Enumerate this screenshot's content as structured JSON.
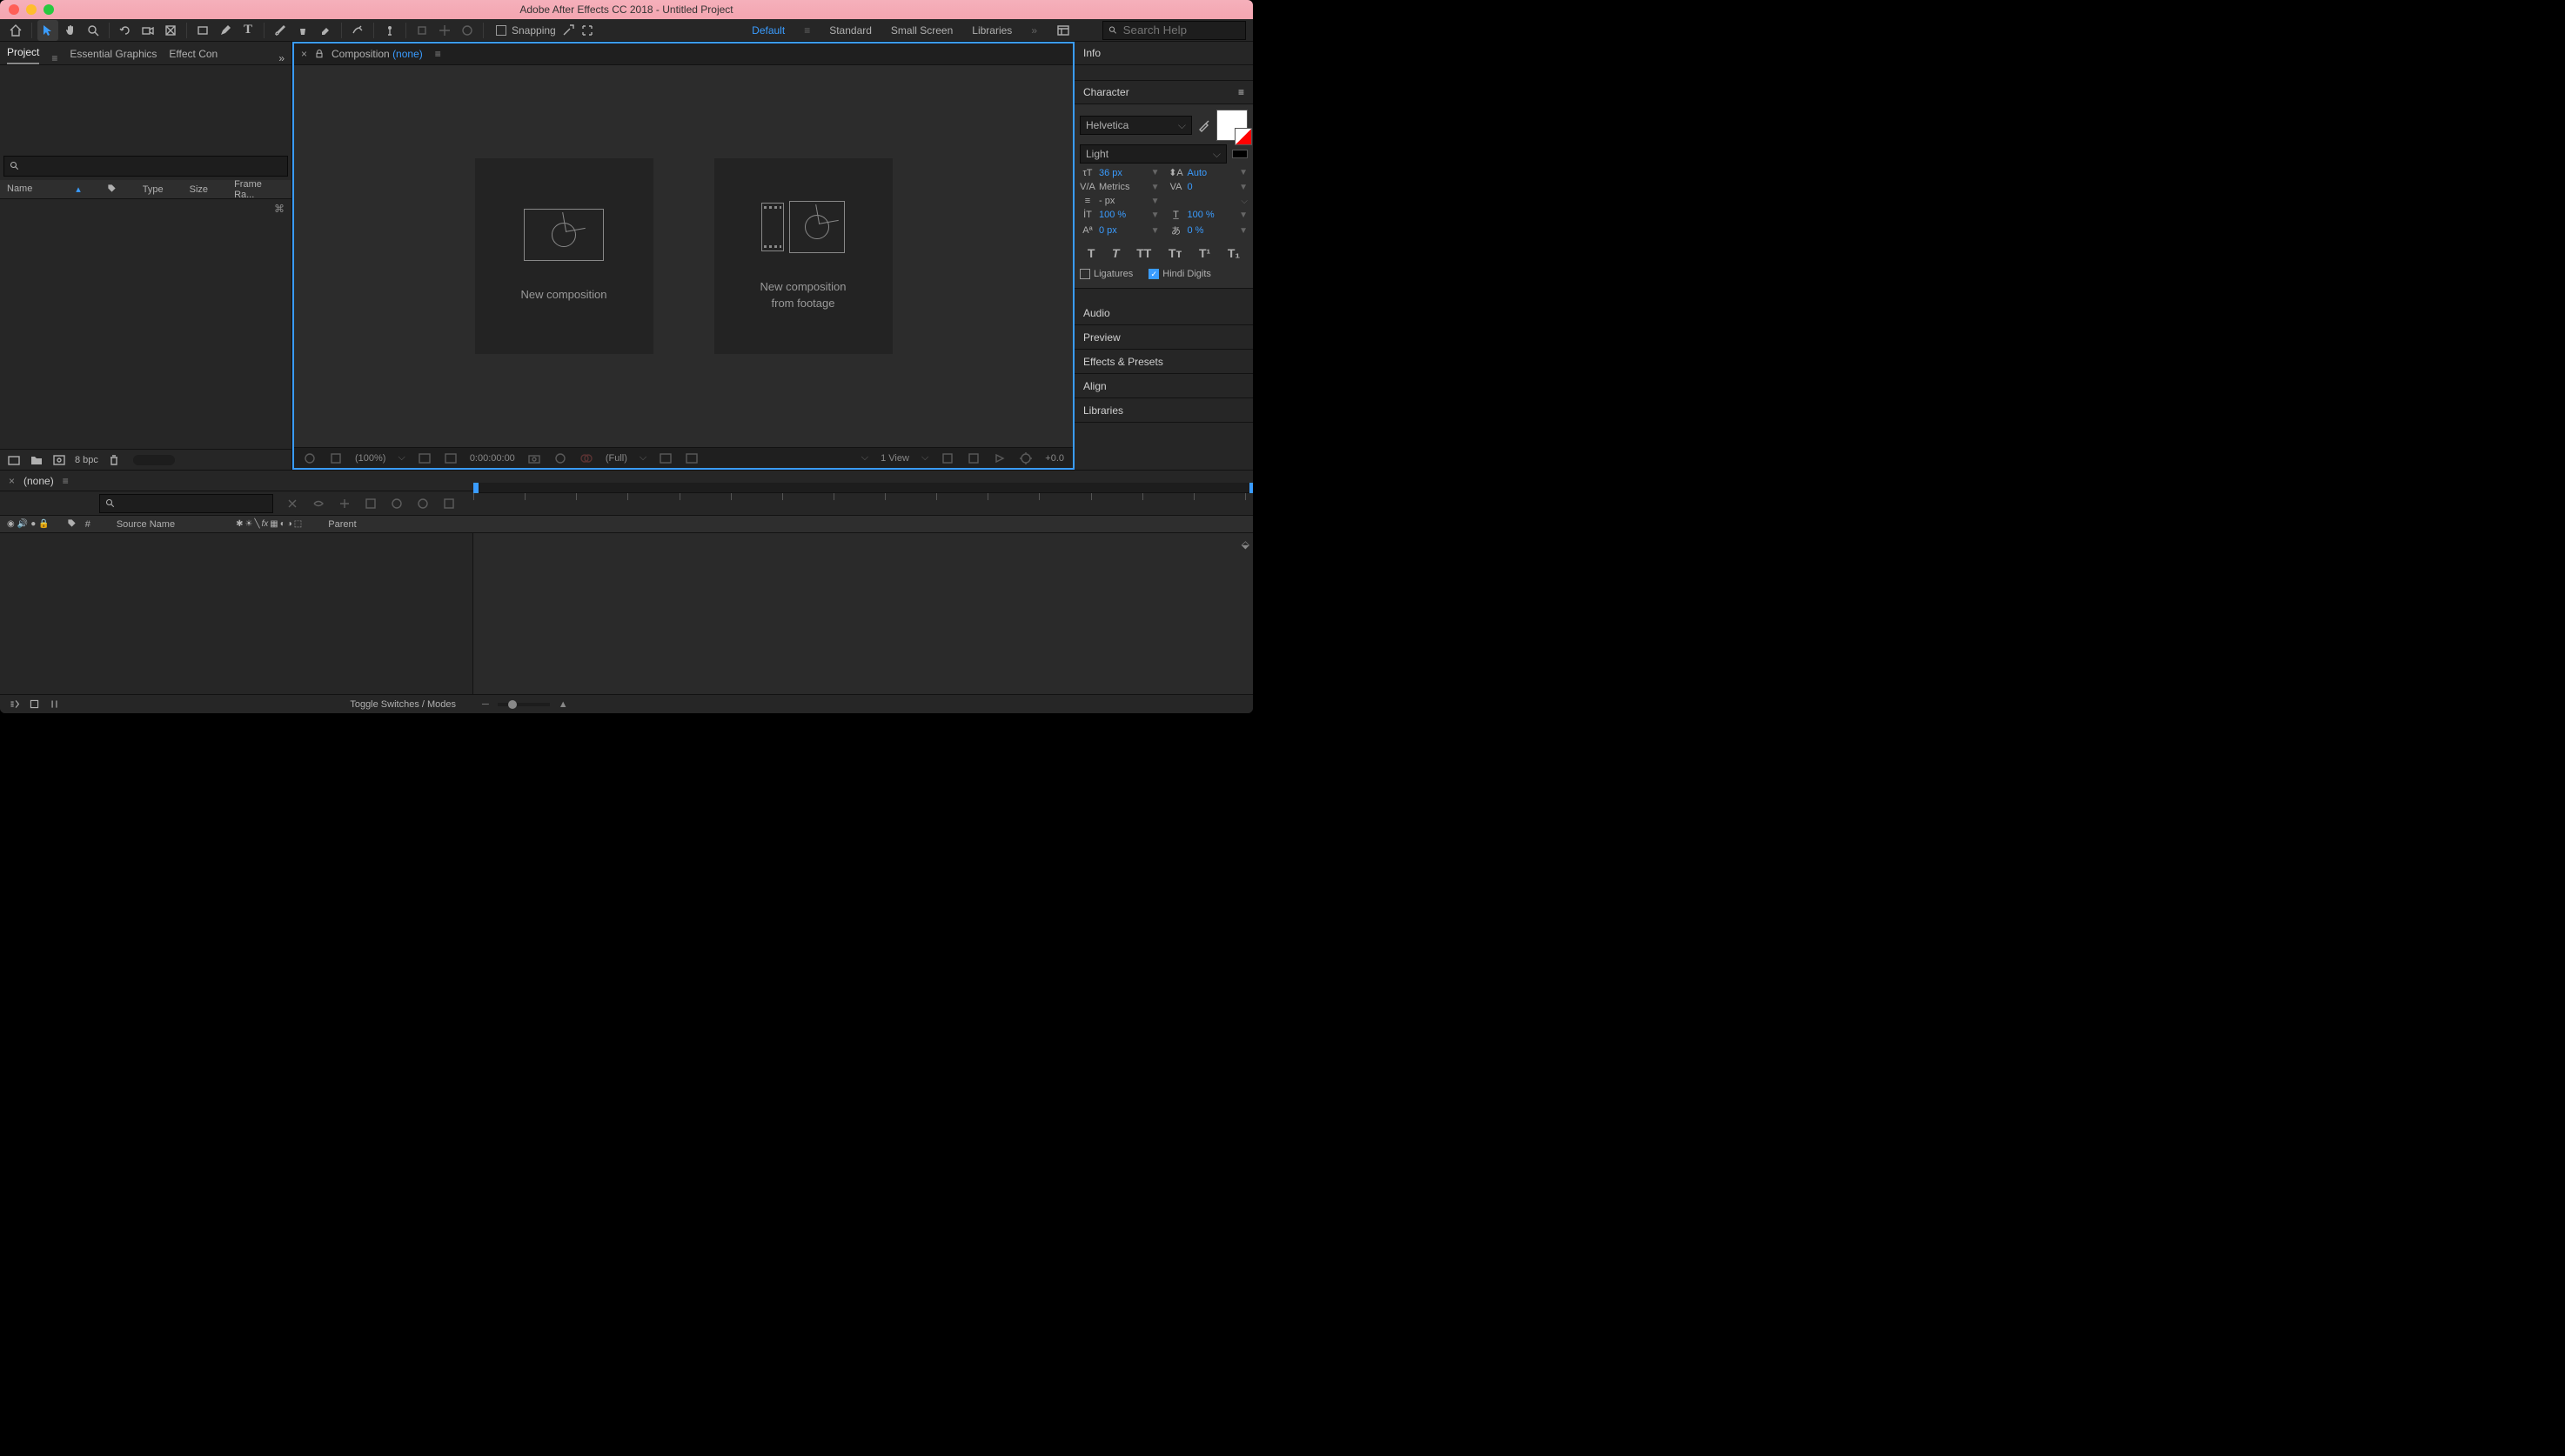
{
  "window": {
    "title": "Adobe After Effects CC 2018 - Untitled Project"
  },
  "toolbar": {
    "snapping": "Snapping",
    "workspaces": {
      "default": "Default",
      "standard": "Standard",
      "small": "Small Screen",
      "libraries": "Libraries"
    },
    "search_placeholder": "Search Help"
  },
  "panels": {
    "project": "Project",
    "essential_graphics": "Essential Graphics",
    "effect_controls": "Effect Con",
    "cols": {
      "name": "Name",
      "type": "Type",
      "size": "Size",
      "frame": "Frame Ra..."
    },
    "bpc": "8 bpc"
  },
  "composition": {
    "label": "Composition",
    "none": "(none)",
    "new_comp": "New composition",
    "new_from_footage_1": "New composition",
    "new_from_footage_2": "from footage",
    "zoom": "(100%)",
    "time": "0:00:00:00",
    "res": "(Full)",
    "view": "1 View",
    "exposure": "+0.0"
  },
  "right": {
    "info": "Info",
    "character": "Character",
    "font": "Helvetica",
    "weight": "Light",
    "size": "36 px",
    "leading": "Auto",
    "kerning": "Metrics",
    "tracking": "0",
    "stroke": "- px",
    "vscale": "100 %",
    "hscale": "100 %",
    "baseline": "0 px",
    "tsume": "0 %",
    "ligatures": "Ligatures",
    "hindi": "Hindi Digits",
    "audio": "Audio",
    "preview": "Preview",
    "effects": "Effects & Presets",
    "align": "Align",
    "libraries": "Libraries"
  },
  "timeline": {
    "none": "(none)",
    "hash": "#",
    "source": "Source Name",
    "parent": "Parent",
    "toggle": "Toggle Switches / Modes"
  }
}
